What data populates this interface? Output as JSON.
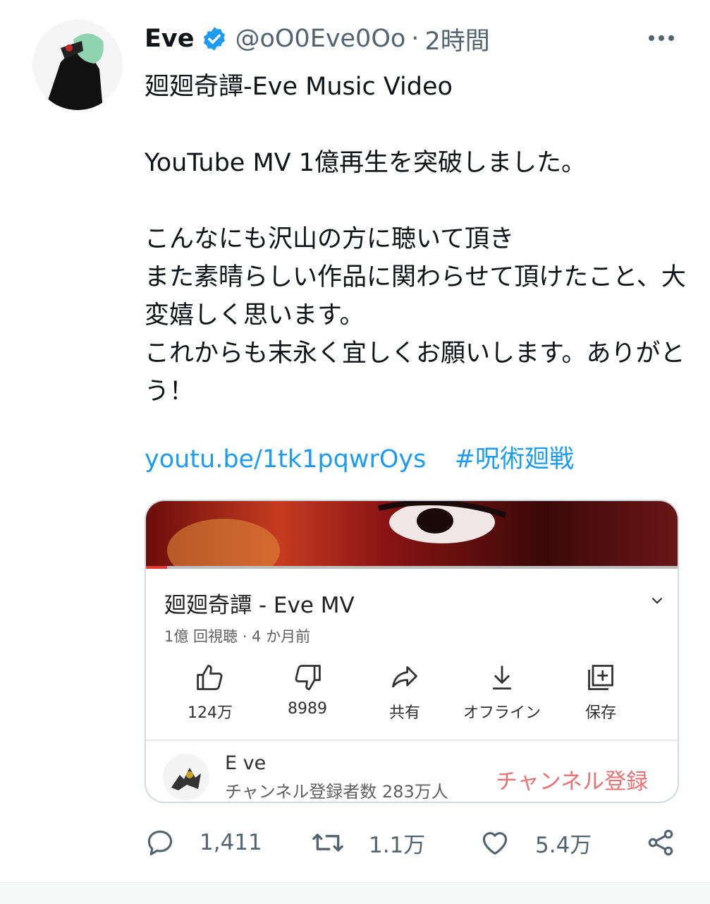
{
  "tweet": {
    "author_name": "Eve",
    "author_handle": "@oO0Eve0Oo",
    "separator": "·",
    "time": "2時間",
    "paragraphs": [
      "廻廻奇譚-Eve Music Video",
      "YouTube MV 1億再生を突破しました。",
      "こんなにも沢山の方に聴いて頂き\nまた素晴らしい作品に関わらせて頂けたこと、大変嬉しく思います。\nこれからも末永く宜しくお願いします。ありがとう！"
    ],
    "link": "youtu.be/1tk1pqwrOys",
    "hashtag": "#呪術廻戦",
    "icons": {
      "verified": "verified-badge-icon",
      "more": "more-dots-icon"
    },
    "colors": {
      "link": "#1d9bf0",
      "verified": "#1d9bf0",
      "secondary": "#536471"
    }
  },
  "youtube_card": {
    "title": "廻廻奇譚 - Eve MV",
    "meta": "1億 回視聴 · 4 か月前",
    "actions": [
      {
        "icon": "thumbs-up-icon",
        "label": "124万"
      },
      {
        "icon": "thumbs-down-icon",
        "label": "8989"
      },
      {
        "icon": "share-arrow-icon",
        "label": "共有"
      },
      {
        "icon": "download-icon",
        "label": "オフライン"
      },
      {
        "icon": "playlist-add-icon",
        "label": "保存"
      }
    ],
    "channel_name": "E ve",
    "channel_subs": "チャンネル登録者数 283万人",
    "subscribe_label": "チャンネル登録",
    "progress_fraction": 0.04,
    "colors": {
      "subscribe": "#e57373",
      "progress": "#e53935"
    }
  },
  "stats": {
    "replies": "1,411",
    "retweets": "1.1万",
    "likes": "5.4万",
    "icons": [
      "reply-icon",
      "retweet-icon",
      "like-heart-icon",
      "share-icon"
    ]
  }
}
